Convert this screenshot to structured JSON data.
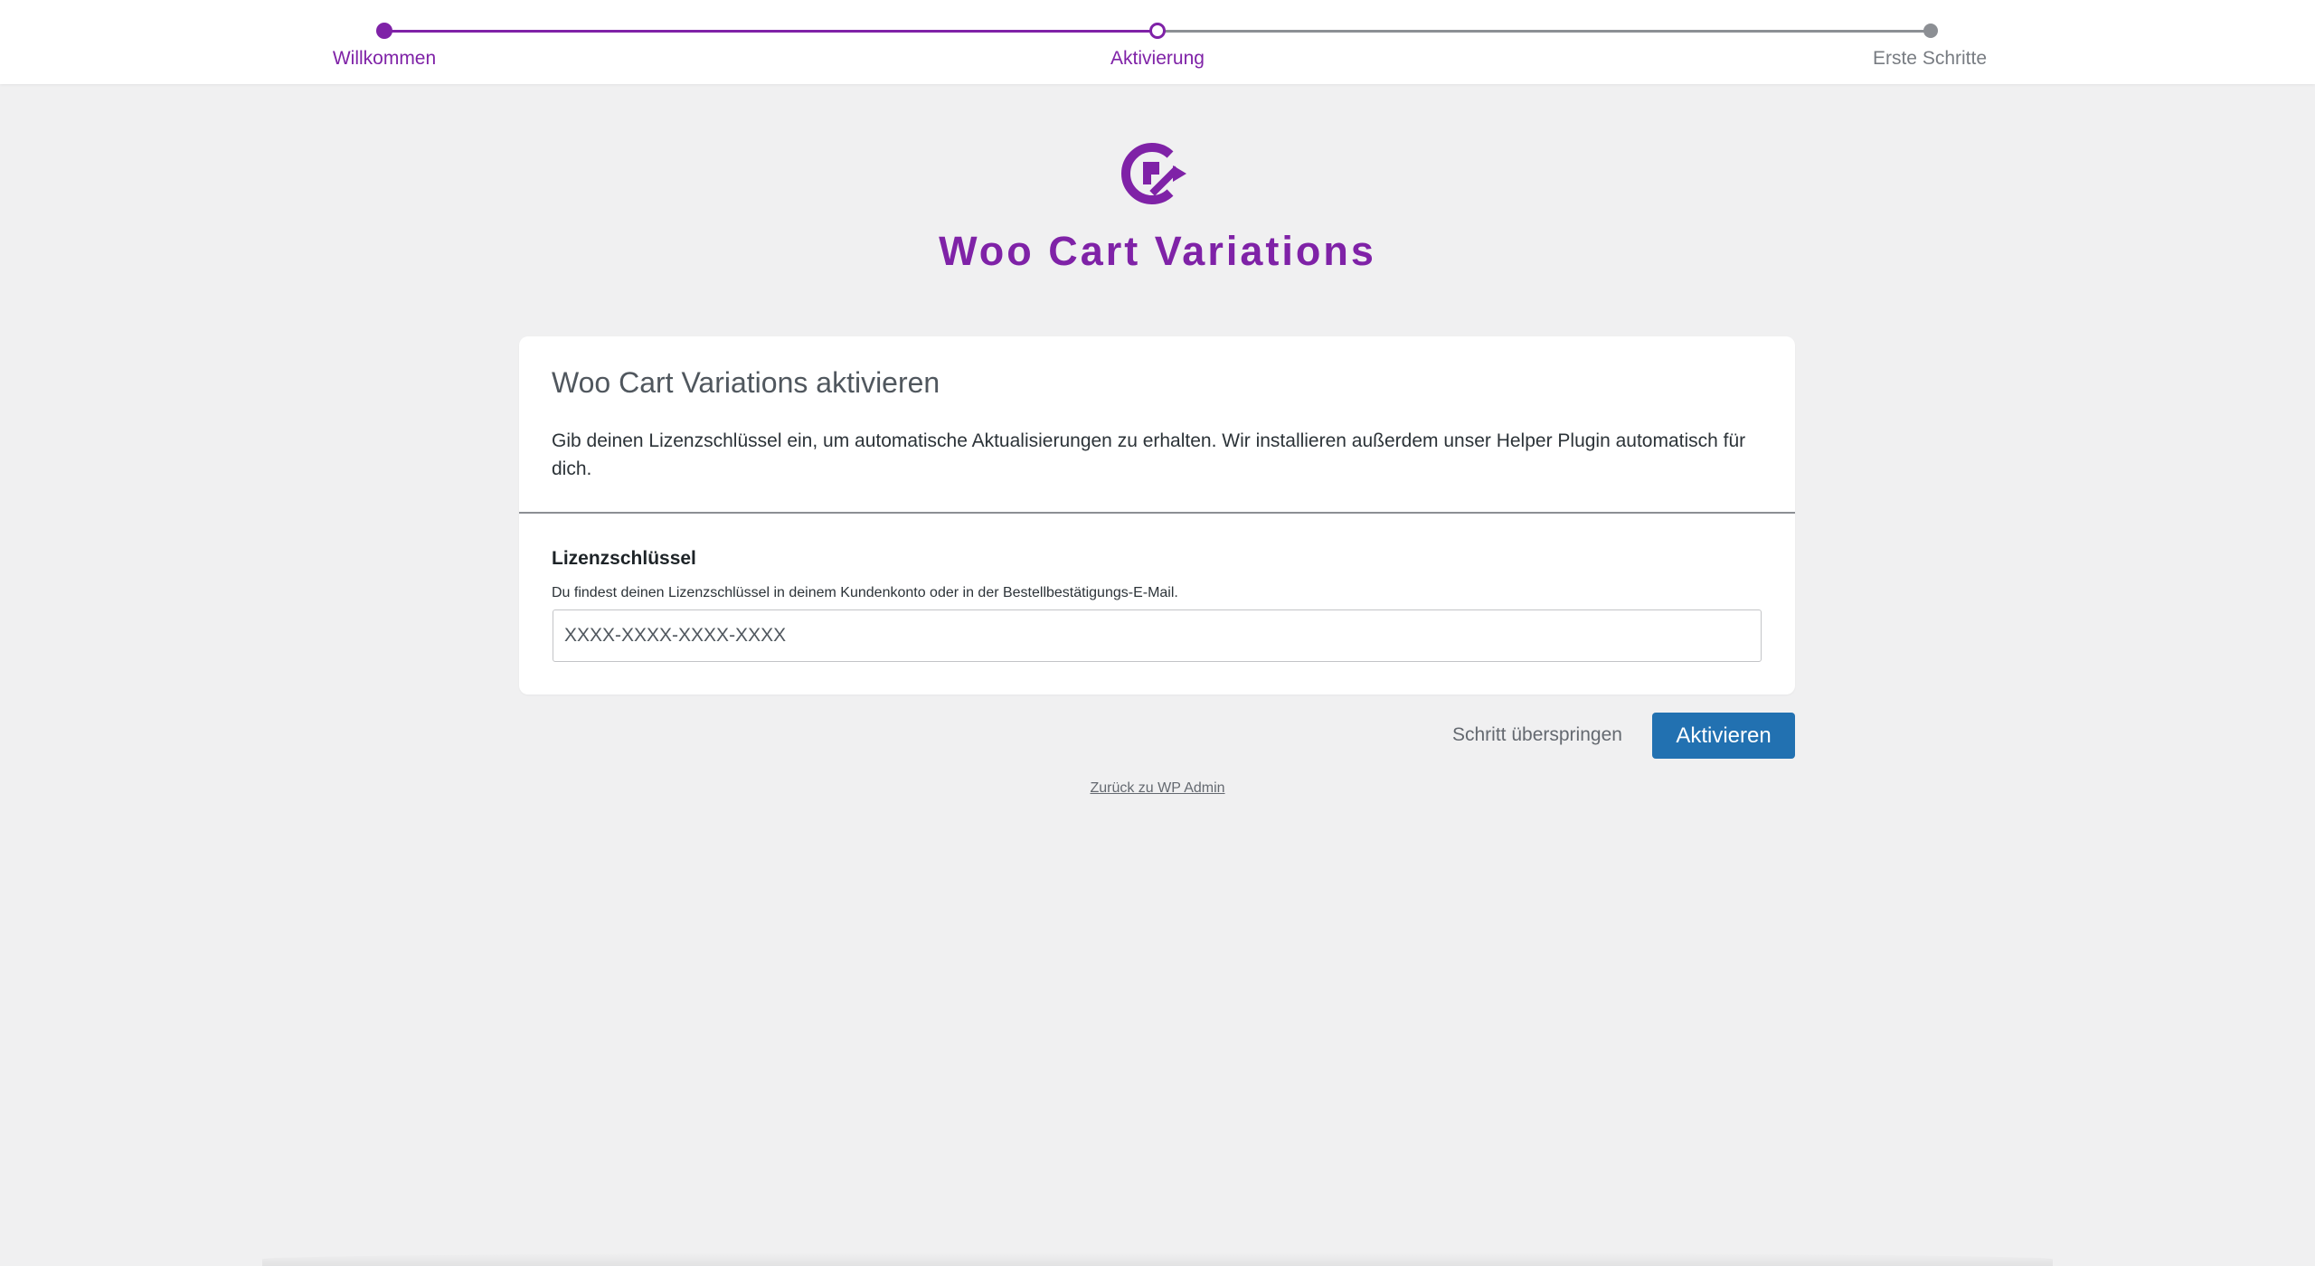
{
  "stepper": {
    "steps": [
      {
        "label": "Willkommen",
        "state": "completed"
      },
      {
        "label": "Aktivierung",
        "state": "current"
      },
      {
        "label": "Erste Schritte",
        "state": "upcoming"
      }
    ]
  },
  "header": {
    "logo_icon": "woo-cart-variations-logo-icon",
    "plugin_name": "Woo Cart Variations"
  },
  "card": {
    "heading": "Woo Cart Variations aktivieren",
    "intro": "Gib deinen Lizenzschlüssel ein, um automatische Aktualisierungen zu erhalten. Wir installieren außerdem unser Helper Plugin automatisch für dich.",
    "license": {
      "label": "Lizenzschlüssel",
      "help": "Du findest deinen Lizenzschlüssel in deinem Kundenkonto oder in der Bestellbestätigungs-E-Mail.",
      "placeholder": "XXXX-XXXX-XXXX-XXXX",
      "value": ""
    }
  },
  "actions": {
    "skip_label": "Schritt überspringen",
    "activate_label": "Aktivieren",
    "back_link_label": "Zurück zu WP Admin"
  },
  "colors": {
    "brand_purple": "#7f22a7",
    "primary_blue": "#2271b1",
    "page_background": "#f0f0f1",
    "inactive_gray": "#8c8f94"
  }
}
